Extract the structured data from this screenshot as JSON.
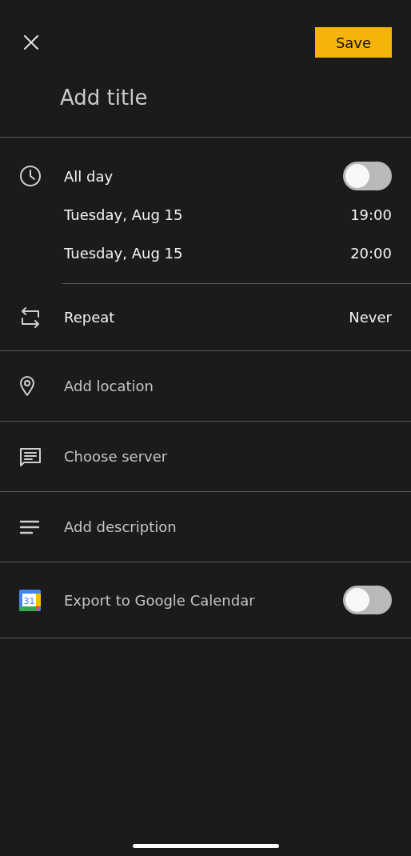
{
  "header": {
    "save": "Save"
  },
  "title": {
    "placeholder": "Add title"
  },
  "all_day": {
    "label": "All day",
    "on": false
  },
  "times": [
    {
      "date": "Tuesday, Aug 15",
      "time": "19:00"
    },
    {
      "date": "Tuesday, Aug 15",
      "time": "20:00"
    }
  ],
  "repeat": {
    "label": "Repeat",
    "value": "Never"
  },
  "fields": [
    {
      "kind": "location",
      "placeholder": "Add location"
    },
    {
      "kind": "server",
      "placeholder": "Choose server"
    },
    {
      "kind": "description",
      "placeholder": "Add description"
    }
  ],
  "export": {
    "label": "Export to Google Calendar",
    "on": false,
    "icon_badge": "31"
  }
}
